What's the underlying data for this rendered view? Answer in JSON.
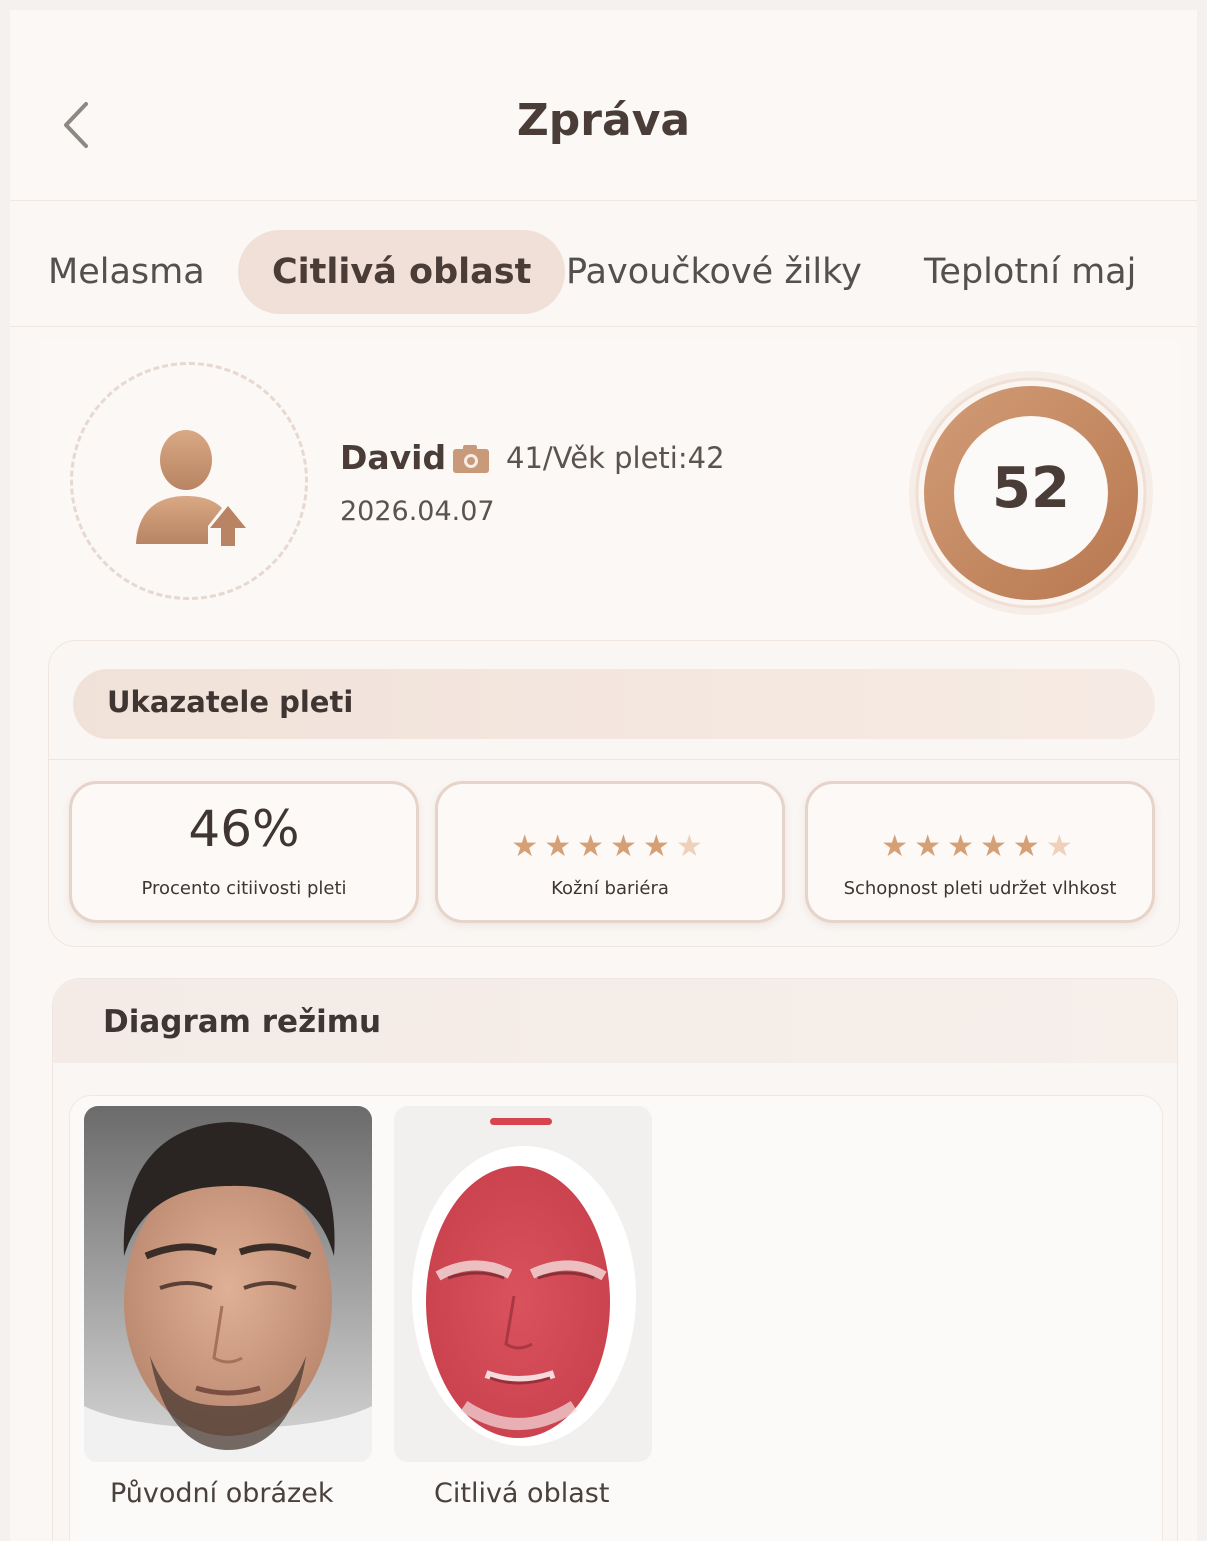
{
  "header": {
    "title": "Zpráva"
  },
  "tabs": [
    {
      "label": "Melasma",
      "active": false
    },
    {
      "label": "Citlivá oblast",
      "active": true
    },
    {
      "label": "Pavoučkové žilky",
      "active": false
    },
    {
      "label": "Teplotní maj",
      "active": false
    }
  ],
  "profile": {
    "name": "David",
    "age_line": "41/Věk pleti:42",
    "date": "2026.04.07",
    "score": "52"
  },
  "indicators": {
    "title": "Ukazatele pleti",
    "items": [
      {
        "value": "46%",
        "label": "Procento citiivosti pleti"
      },
      {
        "rating": 5.5,
        "max": 6,
        "label": "Kožní bariéra"
      },
      {
        "rating": 5.5,
        "max": 6,
        "label": "Schopnost pleti udržet vlhkost"
      }
    ]
  },
  "diagram": {
    "title": "Diagram režimu",
    "images": [
      {
        "label": "Původní obrázek"
      },
      {
        "label": "Citlivá oblast"
      }
    ]
  },
  "colors": {
    "accent": "#c88c63",
    "tab_active_bg": "#f0e0d7",
    "sensitive_red": "#d94a55"
  }
}
